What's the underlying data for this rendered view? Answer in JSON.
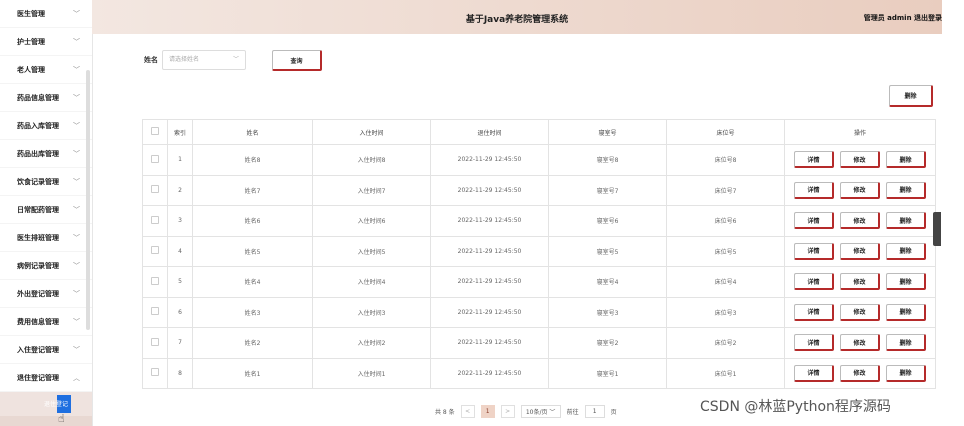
{
  "header": {
    "title": "基于Java养老院管理系统",
    "user": "管理员 admin  退出登录"
  },
  "sidebar": {
    "items": [
      {
        "label": "医生管理",
        "chev": "﹀"
      },
      {
        "label": "护士管理",
        "chev": "﹀"
      },
      {
        "label": "老人管理",
        "chev": "﹀"
      },
      {
        "label": "药品信息管理",
        "chev": "﹀"
      },
      {
        "label": "药品入库管理",
        "chev": "﹀"
      },
      {
        "label": "药品出库管理",
        "chev": "﹀"
      },
      {
        "label": "饮食记录管理",
        "chev": "﹀"
      },
      {
        "label": "日常配药管理",
        "chev": "﹀"
      },
      {
        "label": "医生排班管理",
        "chev": "﹀"
      },
      {
        "label": "病例记录管理",
        "chev": "﹀"
      },
      {
        "label": "外出登记管理",
        "chev": "﹀"
      },
      {
        "label": "费用信息管理",
        "chev": "﹀"
      },
      {
        "label": "入住登记管理",
        "chev": "﹀"
      },
      {
        "label": "退住登记管理",
        "chev": "︿"
      }
    ],
    "sub_selected": "退住登记",
    "sub_next": "健康档案管理"
  },
  "search": {
    "label": "姓名",
    "placeholder": "请选择姓名",
    "query": "查询"
  },
  "toolbar": {
    "delete": "删除"
  },
  "table": {
    "headers": [
      "",
      "索引",
      "姓名",
      "入住时间",
      "退住时间",
      "寝室号",
      "床位号",
      "操作"
    ],
    "rows": [
      {
        "idx": "1",
        "name": "姓名8",
        "in": "入住时间8",
        "out": "2022-11-29 12:45:50",
        "room": "寝室号8",
        "bed": "床位号8"
      },
      {
        "idx": "2",
        "name": "姓名7",
        "in": "入住时间7",
        "out": "2022-11-29 12:45:50",
        "room": "寝室号7",
        "bed": "床位号7"
      },
      {
        "idx": "3",
        "name": "姓名6",
        "in": "入住时间6",
        "out": "2022-11-29 12:45:50",
        "room": "寝室号6",
        "bed": "床位号6"
      },
      {
        "idx": "4",
        "name": "姓名5",
        "in": "入住时间5",
        "out": "2022-11-29 12:45:50",
        "room": "寝室号5",
        "bed": "床位号5"
      },
      {
        "idx": "5",
        "name": "姓名4",
        "in": "入住时间4",
        "out": "2022-11-29 12:45:50",
        "room": "寝室号4",
        "bed": "床位号4"
      },
      {
        "idx": "6",
        "name": "姓名3",
        "in": "入住时间3",
        "out": "2022-11-29 12:45:50",
        "room": "寝室号3",
        "bed": "床位号3"
      },
      {
        "idx": "7",
        "name": "姓名2",
        "in": "入住时间2",
        "out": "2022-11-29 12:45:50",
        "room": "寝室号2",
        "bed": "床位号2"
      },
      {
        "idx": "8",
        "name": "姓名1",
        "in": "入住时间1",
        "out": "2022-11-29 12:45:50",
        "room": "寝室号1",
        "bed": "床位号1"
      }
    ],
    "actions": {
      "detail": "详情",
      "edit": "修改",
      "delete": "删除"
    }
  },
  "pager": {
    "total": "共 8 条",
    "prev": "<",
    "page": "1",
    "next": ">",
    "size": "10条/页 ﹀",
    "goto": "前往",
    "goto_value": "1",
    "page_unit": "页"
  },
  "watermark": "CSDN @林蓝Python程序源码",
  "colors": {
    "accent": "#b52a2a",
    "header_start": "#f3e7e1",
    "header_end": "#e9cdbf",
    "selected": "#1f6fe0"
  }
}
